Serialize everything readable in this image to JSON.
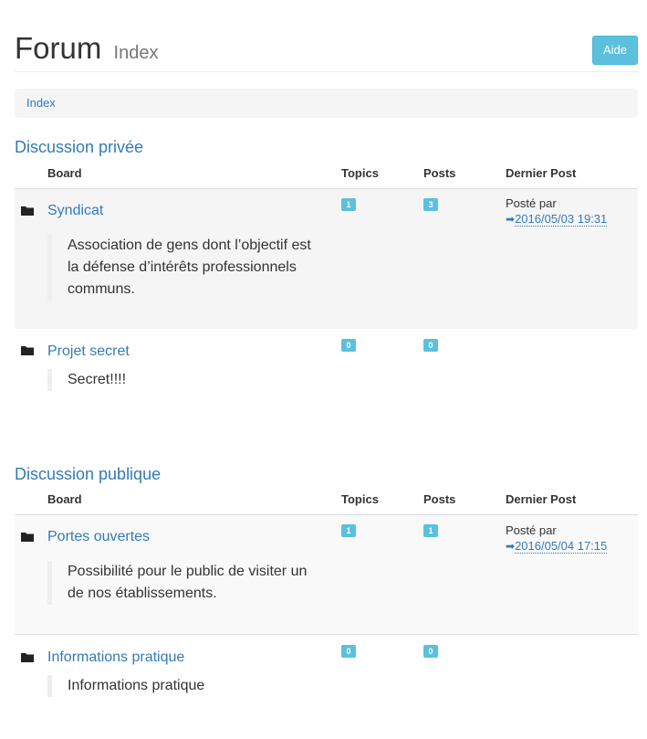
{
  "header": {
    "title": "Forum",
    "subtitle": "Index",
    "help_label": "Aide"
  },
  "breadcrumb": {
    "items": [
      "Index"
    ]
  },
  "columns": {
    "board": "Board",
    "topics": "Topics",
    "posts": "Posts",
    "last_post": "Dernier Post"
  },
  "categories": [
    {
      "title": "Discussion privée",
      "boards": [
        {
          "name": "Syndicat",
          "description": "Association de gens dont l’objectif est la défense d’intérêts professionnels communs.",
          "topics": "1",
          "posts": "3",
          "last_post_prefix": "Posté par",
          "last_post_date": "2016/05/03 19:31"
        },
        {
          "name": "Projet secret",
          "description": "Secret!!!!",
          "topics": "0",
          "posts": "0"
        }
      ]
    },
    {
      "title": "Discussion publique",
      "boards": [
        {
          "name": "Portes ouvertes",
          "description": "Possibilité pour le public de visiter un de nos établissements.",
          "topics": "1",
          "posts": "1",
          "last_post_prefix": "Posté par",
          "last_post_date": "2016/05/04 17:15"
        },
        {
          "name": "Informations pratique",
          "description": "Informations pratique",
          "topics": "0",
          "posts": "0"
        }
      ]
    }
  ],
  "colors": {
    "link": "#337ab7",
    "badge": "#5bc0de",
    "stripe": "#f5f5f5"
  },
  "icons": {
    "board": "folder-icon",
    "last_post": "arrow-right-icon"
  }
}
